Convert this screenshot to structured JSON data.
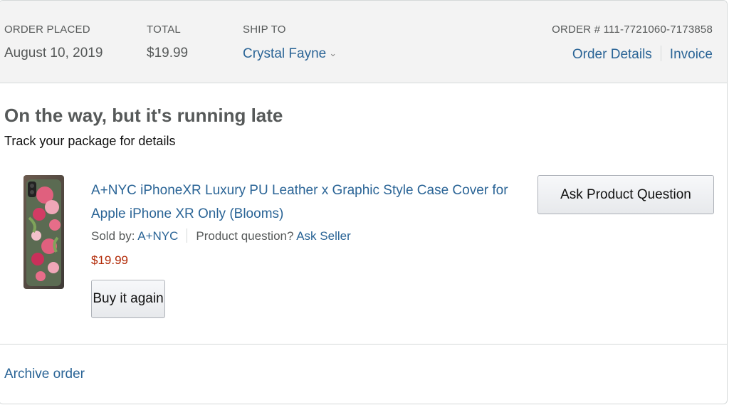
{
  "header": {
    "order_placed_label": "ORDER PLACED",
    "order_placed_value": "August 10, 2019",
    "total_label": "TOTAL",
    "total_value": "$19.99",
    "ship_to_label": "SHIP TO",
    "ship_to_value": "Crystal Fayne",
    "order_number": "ORDER # 111-7721060-7173858",
    "order_details_link": "Order Details",
    "invoice_link": "Invoice"
  },
  "status": {
    "title": "On the way, but it's running late",
    "subtitle": "Track your package for details"
  },
  "product": {
    "title": "A+NYC iPhoneXR Luxury PU Leather x Graphic Style Case Cover for Apple iPhone XR Only (Blooms)",
    "sold_by_label": "Sold by: ",
    "seller": "A+NYC",
    "question_label": "Product question? ",
    "ask_seller_link": "Ask Seller",
    "price": "$19.99",
    "buy_again_label": "Buy it again",
    "ask_question_label": "Ask Product Question"
  },
  "footer": {
    "archive_link": "Archive order"
  },
  "icons": {
    "ship_to_dropdown": "chevron-down-icon"
  },
  "colors": {
    "link": "#2a6496",
    "price": "#b12704",
    "header_bg": "#f3f3f3"
  }
}
